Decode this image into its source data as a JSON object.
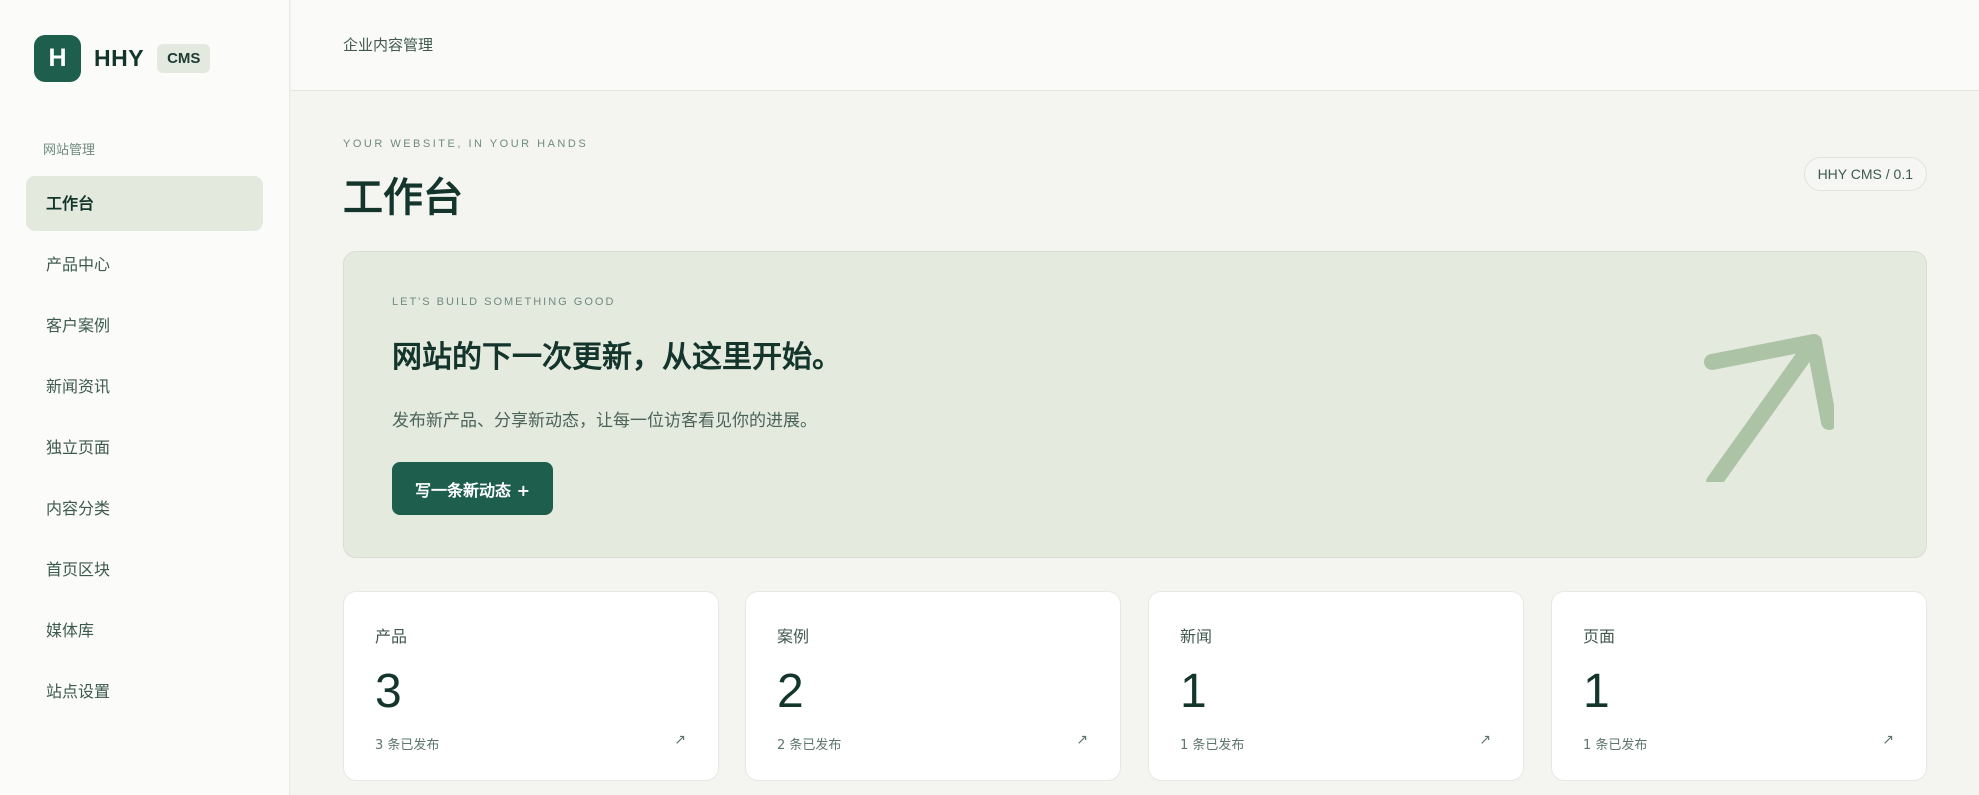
{
  "brand": {
    "logo_letter": "H",
    "name": "HHY",
    "tag": "CMS"
  },
  "sidebar": {
    "section_label": "网站管理",
    "items": [
      {
        "label": "工作台",
        "active": true
      },
      {
        "label": "产品中心"
      },
      {
        "label": "客户案例"
      },
      {
        "label": "新闻资讯"
      },
      {
        "label": "独立页面"
      },
      {
        "label": "内容分类"
      },
      {
        "label": "首页区块"
      },
      {
        "label": "媒体库"
      },
      {
        "label": "站点设置"
      }
    ]
  },
  "topbar": {
    "title": "企业内容管理"
  },
  "header": {
    "eyebrow": "YOUR WEBSITE, IN YOUR HANDS",
    "title": "工作台",
    "version": "HHY CMS / 0.1"
  },
  "hero": {
    "eyebrow": "LET'S BUILD SOMETHING GOOD",
    "title": "网站的下一次更新，从这里开始。",
    "description": "发布新产品、分享新动态，让每一位访客看见你的进展。",
    "button_label": "写一条新动态 +",
    "arrow_icon": "arrow-up-right-icon"
  },
  "stats": [
    {
      "label": "产品",
      "value": "3",
      "sub": "3 条已发布",
      "arrow": "↗"
    },
    {
      "label": "案例",
      "value": "2",
      "sub": "2 条已发布",
      "arrow": "↗"
    },
    {
      "label": "新闻",
      "value": "1",
      "sub": "1 条已发布",
      "arrow": "↗"
    },
    {
      "label": "页面",
      "value": "1",
      "sub": "1 条已发布",
      "arrow": "↗"
    }
  ],
  "colors": {
    "accent": "#1d5e4d",
    "hero_bg": "#e5eadf",
    "active_nav_bg": "#e4e9dd",
    "page_bg": "#f4f5f1"
  }
}
